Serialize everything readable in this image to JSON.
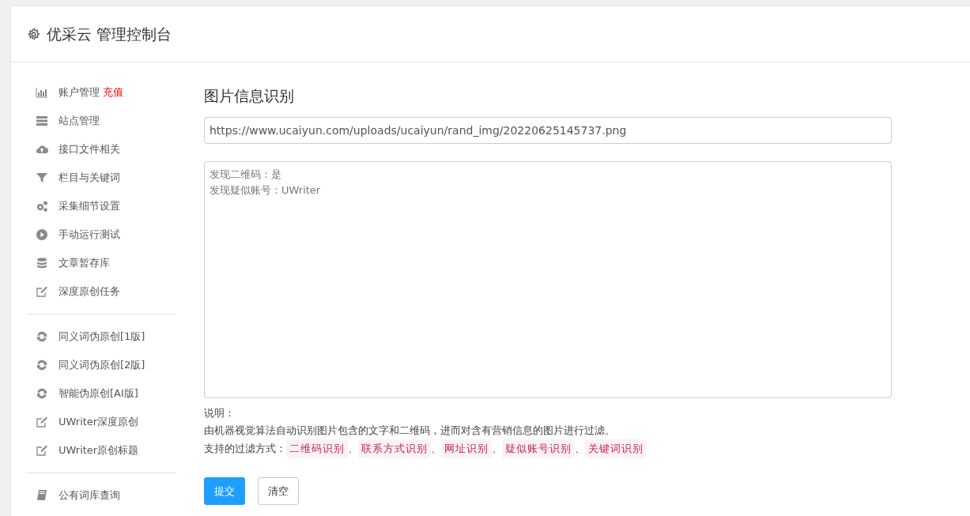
{
  "header": {
    "title": "优采云 管理控制台"
  },
  "sidebar": {
    "groups": [
      {
        "items": [
          {
            "label": "账户管理",
            "badge": "充值"
          },
          {
            "label": "站点管理"
          },
          {
            "label": "接口文件相关"
          },
          {
            "label": "栏目与关键词"
          },
          {
            "label": "采集细节设置"
          },
          {
            "label": "手动运行测试"
          },
          {
            "label": "文章暂存库"
          },
          {
            "label": "深度原创任务"
          }
        ]
      },
      {
        "items": [
          {
            "label": "同义词伪原创[1版]"
          },
          {
            "label": "同义词伪原创[2版]"
          },
          {
            "label": "智能伪原创[AI版]"
          },
          {
            "label": "UWriter深度原创"
          },
          {
            "label": "UWriter原创标题"
          }
        ]
      },
      {
        "items": [
          {
            "label": "公有词库查询"
          }
        ]
      }
    ]
  },
  "main": {
    "title": "图片信息识别",
    "url_field": {
      "value": "https://www.ucaiyun.com/uploads/ucaiyun/rand_img/20220625145737.png"
    },
    "result_box": {
      "lines": [
        "发现二维码：是",
        "发现疑似账号：UWriter"
      ]
    },
    "notes": {
      "heading": "说明：",
      "description": "由机器视觉算法自动识别图片包含的文字和二维码，进而对含有营销信息的图片进行过滤。",
      "filters_label": "支持的过滤方式：",
      "filters": [
        {
          "kind": "tag",
          "text": "二维码识别"
        },
        {
          "kind": "sep",
          "text": "、"
        },
        {
          "kind": "tag",
          "text": "联系方式识别"
        },
        {
          "kind": "sep",
          "text": "、"
        },
        {
          "kind": "tag",
          "text": "网址识别"
        },
        {
          "kind": "sep",
          "text": "、"
        },
        {
          "kind": "tag",
          "text": "疑似账号识别"
        },
        {
          "kind": "sep",
          "text": "、"
        },
        {
          "kind": "tag",
          "text": "关键词识别"
        }
      ]
    },
    "buttons": [
      {
        "kind": "primary",
        "label": "提交"
      },
      {
        "kind": "default",
        "label": "清空"
      }
    ]
  }
}
